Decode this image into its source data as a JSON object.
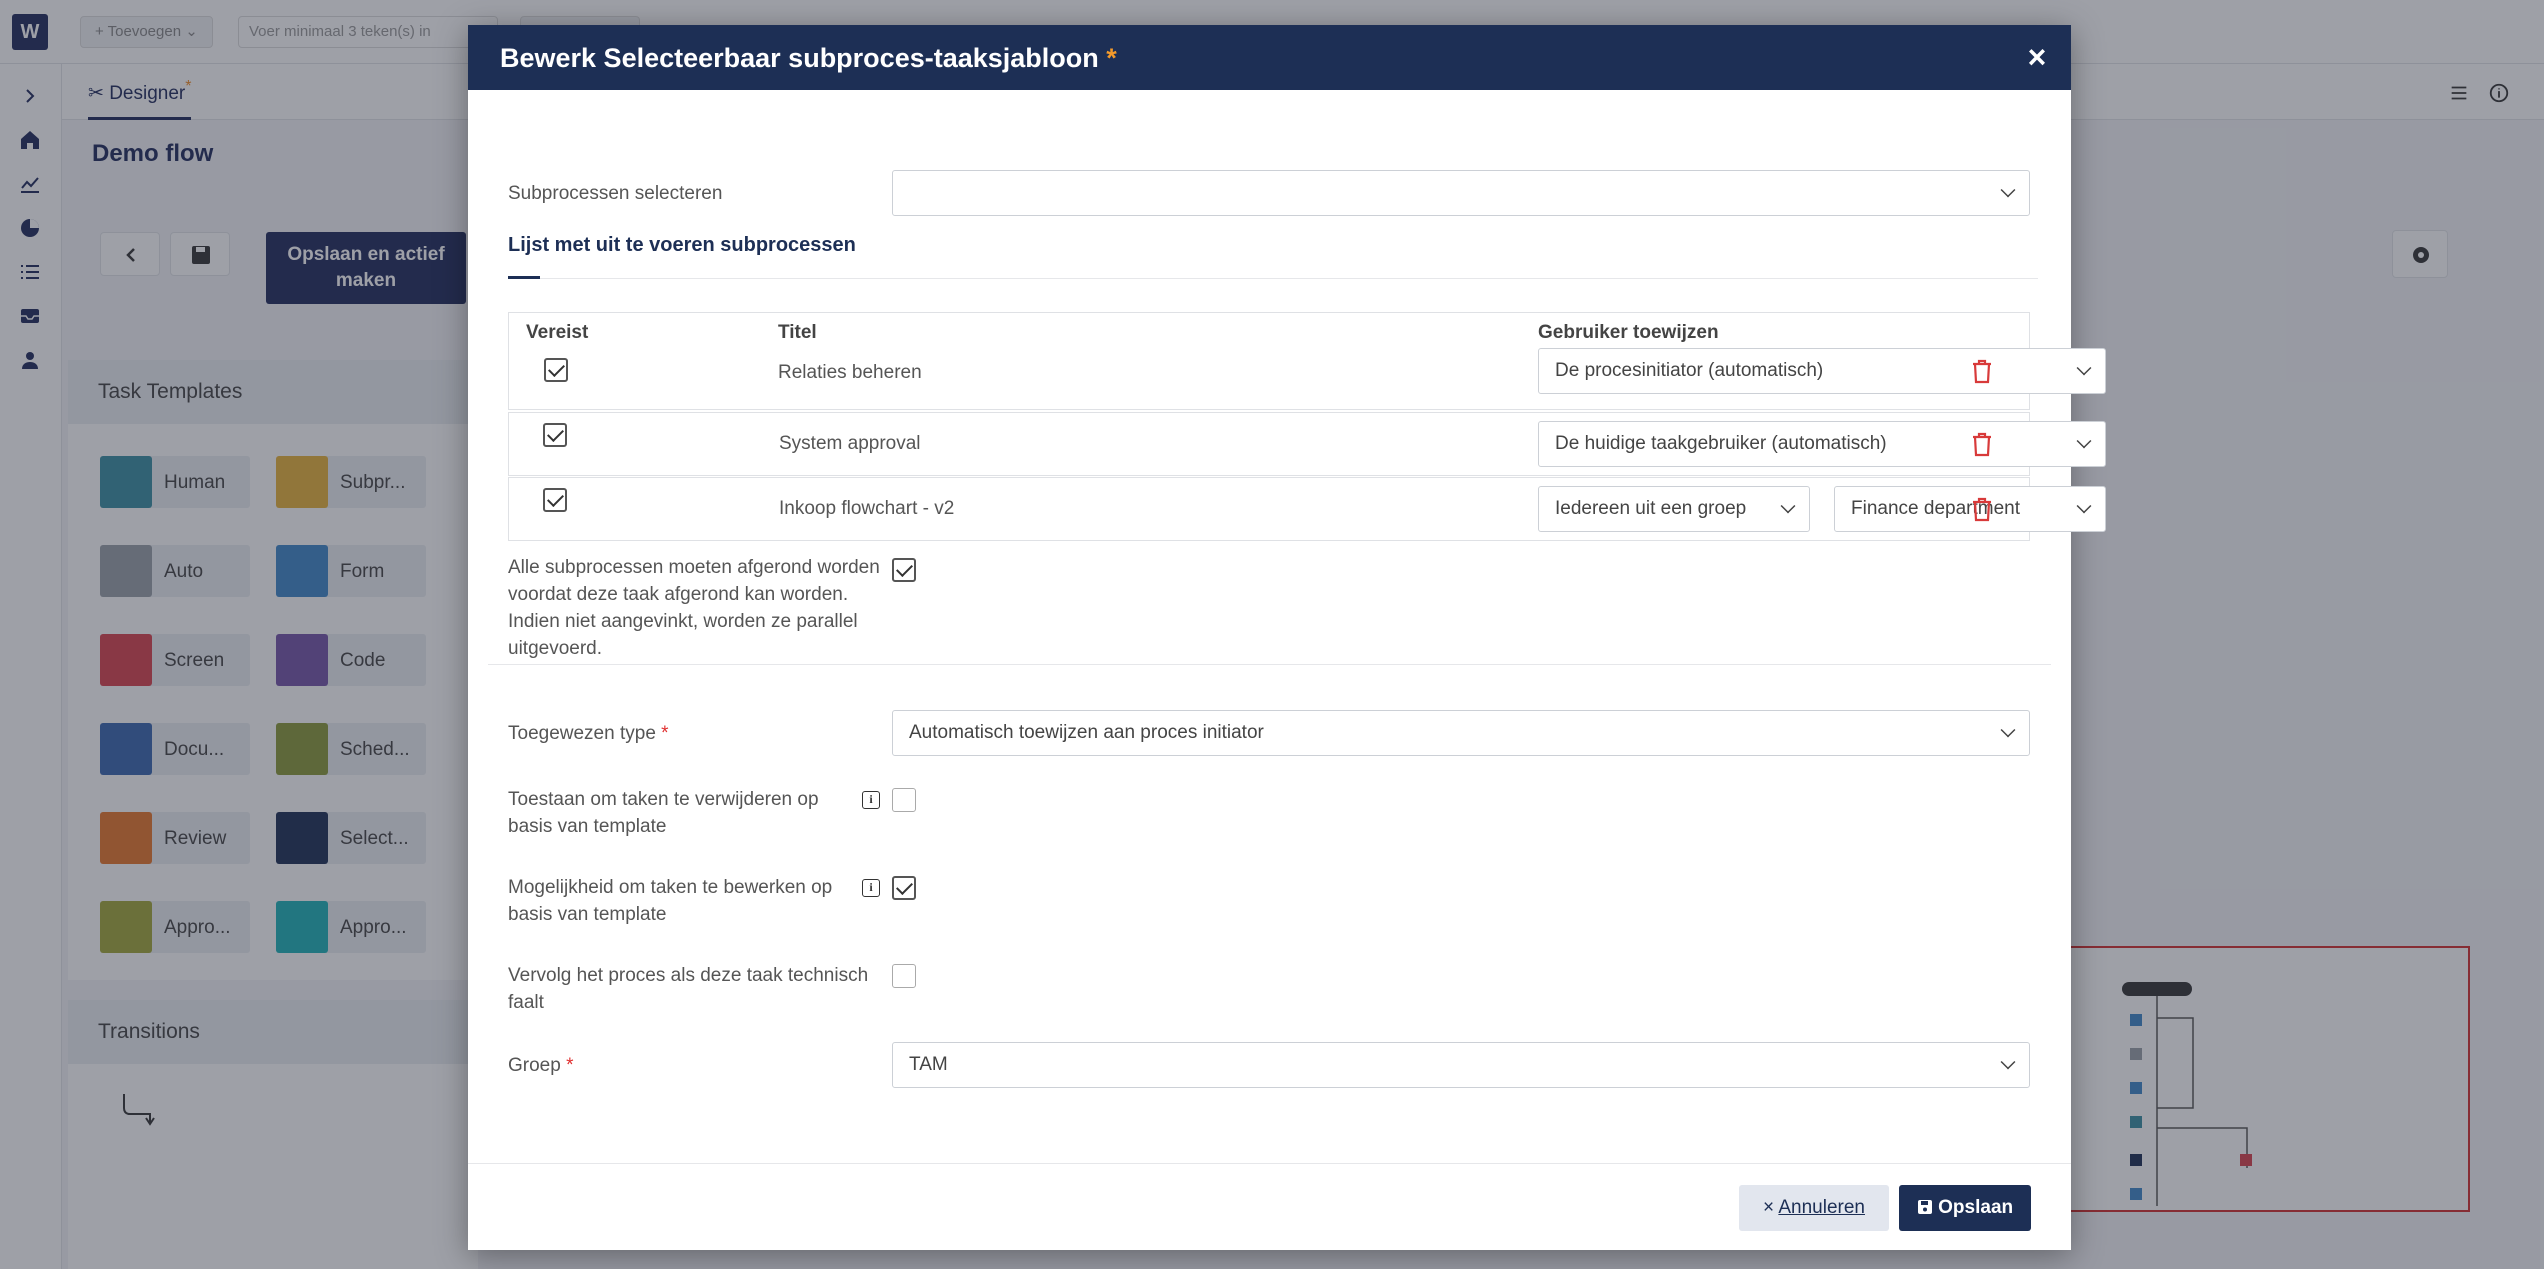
{
  "topbar": {
    "logo": "W",
    "add_label": "+ Toevoegen ⌄",
    "search_placeholder": "Voer minimaal 3 teken(s) in"
  },
  "tabs": {
    "designer": "Designer",
    "designer_dirty": "*"
  },
  "page": {
    "title": "Demo flow",
    "save_active_label": "Opslaan en actief maken"
  },
  "task_templates": {
    "title": "Task Templates",
    "items": [
      {
        "label": "Human",
        "color": "#3a8fa3"
      },
      {
        "label": "Subpr...",
        "color": "#e8b33a"
      },
      {
        "label": "Auto",
        "color": "#9aa0a8"
      },
      {
        "label": "Form",
        "color": "#3e87c9"
      },
      {
        "label": "Screen",
        "color": "#d9434d"
      },
      {
        "label": "Code",
        "color": "#7655a8"
      },
      {
        "label": "Docu...",
        "color": "#3a67b0"
      },
      {
        "label": "Sched...",
        "color": "#8a9a3a"
      },
      {
        "label": "Review",
        "color": "#e8772a"
      },
      {
        "label": "Select...",
        "color": "#1d2f55"
      },
      {
        "label": "Appro...",
        "color": "#a2a83a"
      },
      {
        "label": "Appro...",
        "color": "#1eb3b8"
      }
    ]
  },
  "transitions": {
    "title": "Transitions"
  },
  "modal": {
    "title": "Bewerk Selecteerbaar subproces-taaksjabloon",
    "title_required": "*",
    "subprocesses_label": "Subprocessen selecteren",
    "subprocesses_value": "",
    "subtab": "Lijst met uit te voeren subprocessen",
    "table": {
      "headers": {
        "required": "Vereist",
        "title": "Titel",
        "assign": "Gebruiker toewijzen"
      },
      "rows": [
        {
          "title": "Relaties beheren",
          "required": true,
          "assign": "De procesinitiator (automatisch)",
          "group": ""
        },
        {
          "title": "System approval",
          "required": true,
          "assign": "De huidige taakgebruiker (automatisch)",
          "group": ""
        },
        {
          "title": "Inkoop flowchart - v2",
          "required": true,
          "assign": "Iedereen uit een groep",
          "group": "Finance department"
        }
      ]
    },
    "all_complete_label": "Alle subprocessen moeten afgerond worden voordat deze taak afgerond kan worden. Indien niet aangevinkt, worden ze parallel uitgevoerd.",
    "all_complete_checked": true,
    "assigned_type_label": "Toegewezen type",
    "assigned_type_value": "Automatisch toewijzen aan proces initiator",
    "allow_delete_label": "Toestaan om taken te verwijderen op basis van template",
    "allow_delete_checked": false,
    "allow_edit_label": "Mogelijkheid om taken te bewerken op basis van template",
    "allow_edit_checked": true,
    "continue_label": "Vervolg het proces als deze taak technisch faalt",
    "continue_checked": false,
    "group_label": "Groep",
    "group_value": "TAM",
    "required_marker": "*",
    "cancel_label": "Annuleren",
    "save_label": "Opslaan"
  }
}
